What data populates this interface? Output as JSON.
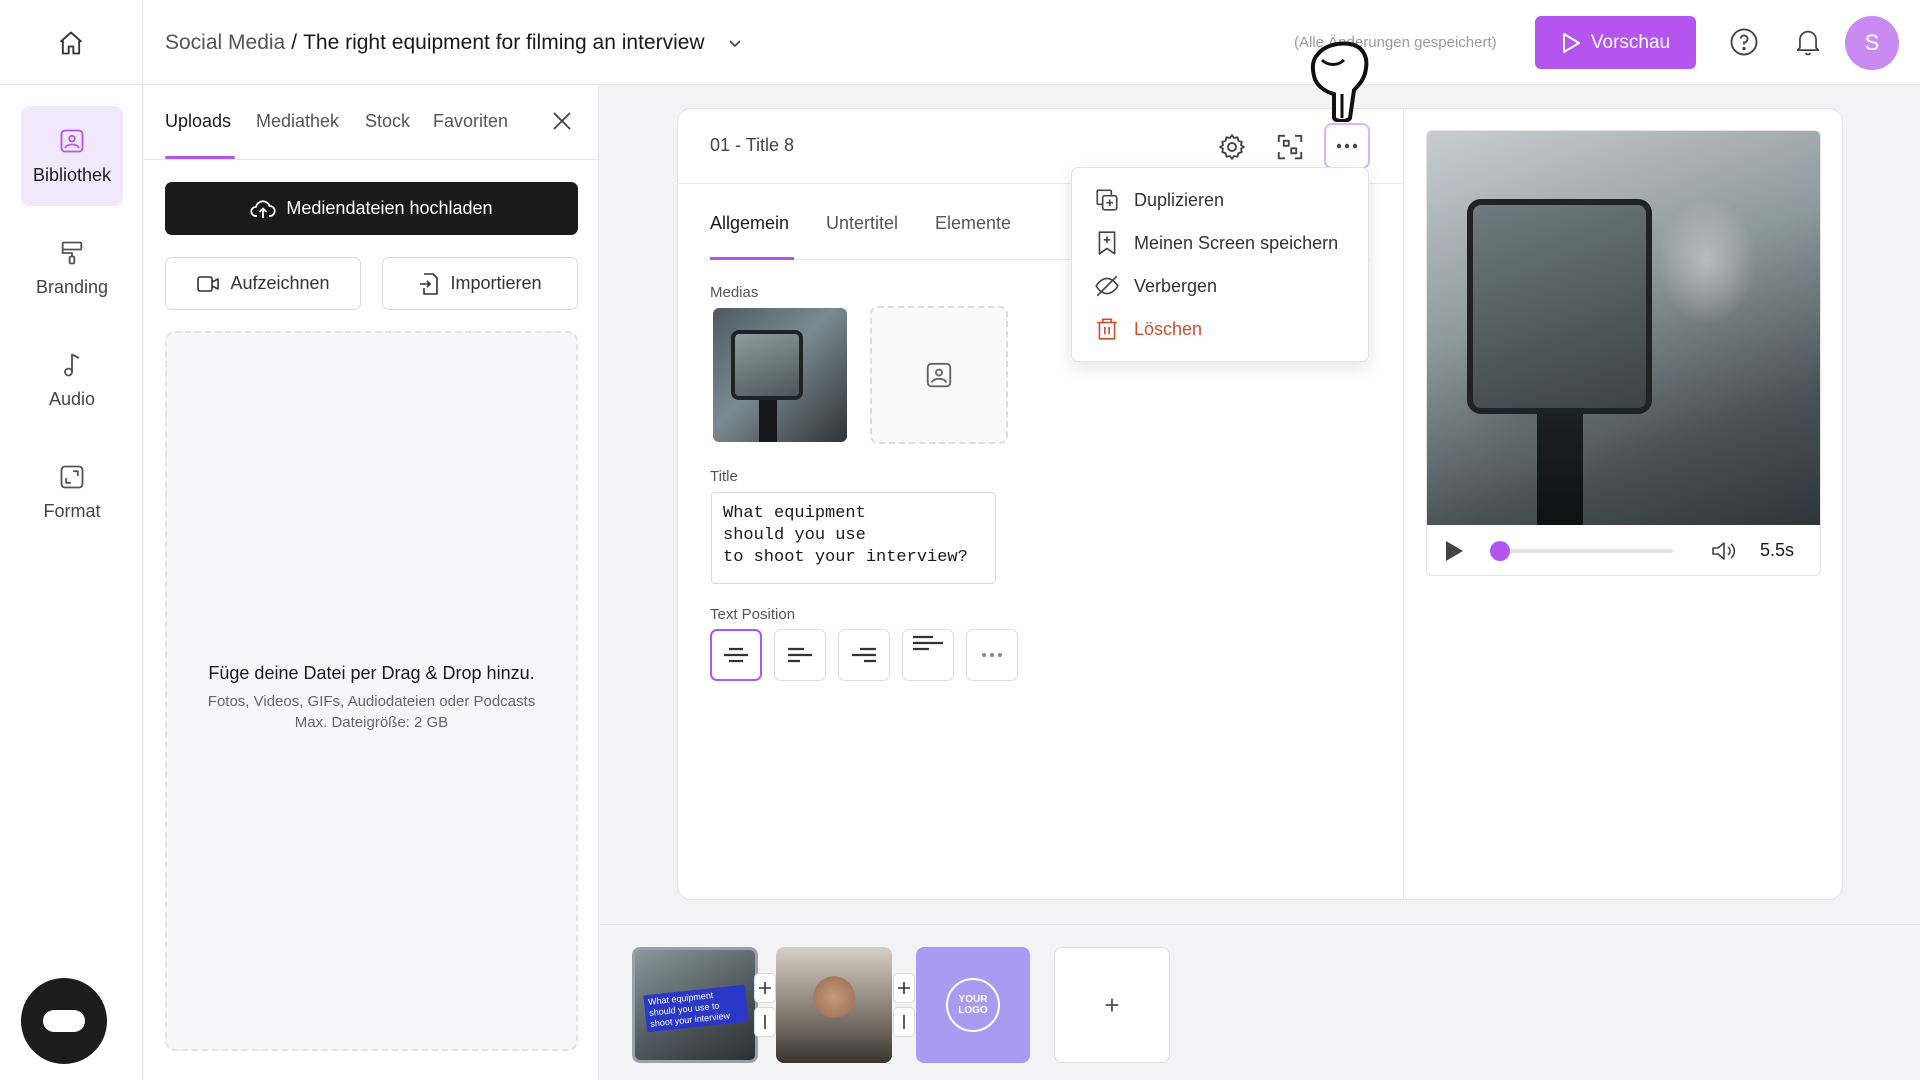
{
  "header": {
    "breadcrumb_parent": "Social Media",
    "separator": "/",
    "project_title": "The right equipment for filming an interview",
    "save_status": "(Alle Änderungen gespeichert)",
    "preview_label": "Vorschau",
    "avatar_initial": "S",
    "accent_color": "#b455f0"
  },
  "rail": {
    "items": [
      {
        "label": "Bibliothek",
        "icon": "library-icon",
        "active": true
      },
      {
        "label": "Branding",
        "icon": "paint-roller-icon",
        "active": false
      },
      {
        "label": "Audio",
        "icon": "music-note-icon",
        "active": false
      },
      {
        "label": "Format",
        "icon": "aspect-ratio-icon",
        "active": false
      }
    ]
  },
  "library": {
    "tabs": [
      "Uploads",
      "Mediathek",
      "Stock",
      "Favoriten"
    ],
    "active_tab": "Uploads",
    "upload_label": "Mediendateien hochladen",
    "record_label": "Aufzeichnen",
    "import_label": "Importieren",
    "dropzone_title": "Füge deine Datei per Drag & Drop hinzu.",
    "dropzone_subtitle": "Fotos, Videos, GIFs, Audiodateien oder Podcasts",
    "dropzone_max": "Max. Dateigröße: 2 GB"
  },
  "editor": {
    "scene_title": "01 - Title 8",
    "tabs": [
      "Allgemein",
      "Untertitel",
      "Elemente"
    ],
    "active_tab": "Allgemein",
    "medias_label": "Medias",
    "title_label": "Title",
    "title_value": "What equipment\nshould you use\nto shoot your interview?",
    "text_position_label": "Text Position",
    "text_positions": [
      "align-center",
      "align-left",
      "align-right",
      "align-top-left",
      "more"
    ],
    "active_text_position": "align-center"
  },
  "menu": {
    "items": [
      {
        "label": "Duplizieren",
        "icon": "duplicate-icon",
        "danger": false
      },
      {
        "label": "Meinen Screen speichern",
        "icon": "bookmark-plus-icon",
        "danger": false
      },
      {
        "label": "Verbergen",
        "icon": "eye-off-icon",
        "danger": false
      },
      {
        "label": "Löschen",
        "icon": "trash-icon",
        "danger": true
      }
    ],
    "danger_color": "#c9502d"
  },
  "player": {
    "duration": "5.5s",
    "progress": 0.03
  },
  "timeline": {
    "scene1_caption": "What equipment should you use to shoot your interview",
    "scene3_logo": "YOUR LOGO",
    "add_label": "+"
  }
}
